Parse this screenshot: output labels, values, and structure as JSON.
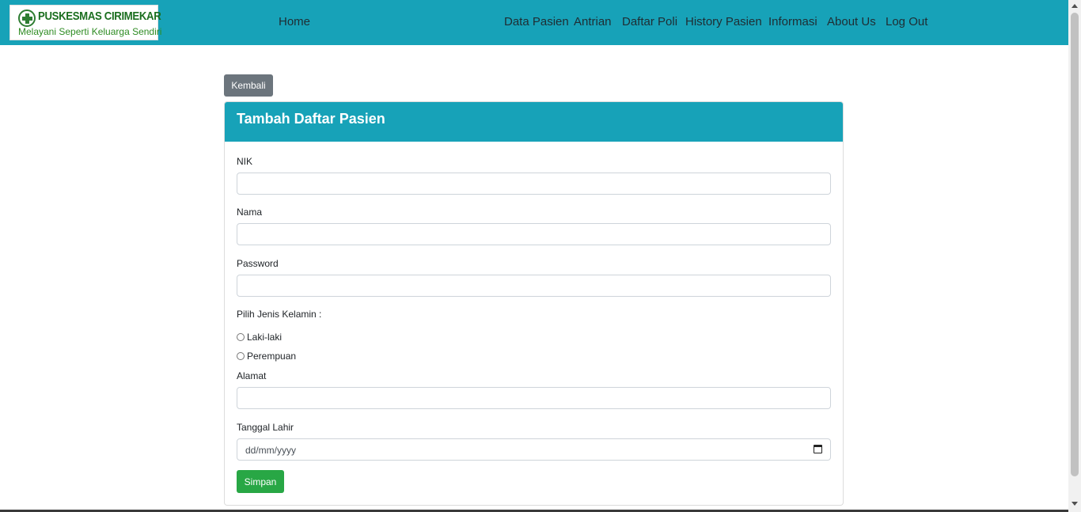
{
  "navbar": {
    "logo_name": "PUSKESMAS CIRIMEKAR",
    "logo_tagline": "Melayani Seperti Keluarga Sendiri",
    "home": "Home",
    "links": [
      "Data Pasien",
      "Antrian",
      "Daftar Poli",
      "History Pasien",
      "Informasi",
      "About Us",
      "Log Out"
    ]
  },
  "back_button": "Kembali",
  "form": {
    "title": "Tambah Daftar Pasien",
    "nik_label": "NIK",
    "nama_label": "Nama",
    "password_label": "Password",
    "gender_label": "Pilih Jenis Kelamin :",
    "gender_options": [
      "Laki-laki",
      "Perempuan"
    ],
    "alamat_label": "Alamat",
    "tanggal_label": "Tanggal Lahir",
    "tanggal_placeholder": "dd/mm/yyyy",
    "submit": "Simpan"
  },
  "colors": {
    "primary": "#17a2b8",
    "secondary": "#6c757d",
    "success": "#28a745"
  },
  "icons": [
    "plus-cross-icon",
    "calendar-icon"
  ]
}
